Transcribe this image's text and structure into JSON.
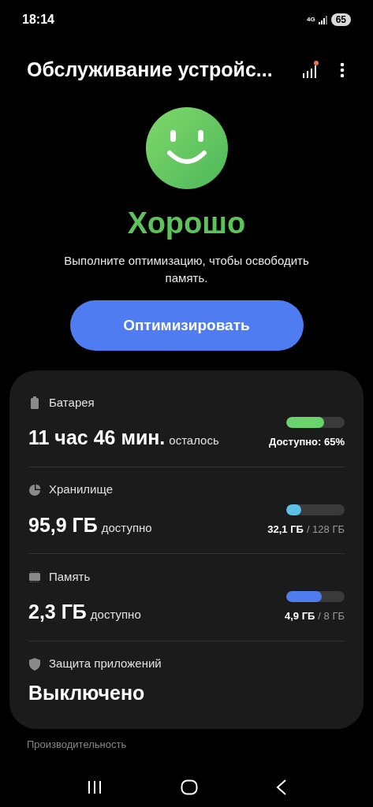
{
  "status_bar": {
    "time": "18:14",
    "network": "4G",
    "battery": "65"
  },
  "app_bar": {
    "title": "Обслуживание устройс...",
    "notification_dot": true
  },
  "status": {
    "label": "Хорошо",
    "message": "Выполните оптимизацию, чтобы освободить память."
  },
  "optimize_button": "Оптимизировать",
  "items": [
    {
      "kind": "battery",
      "title": "Батарея",
      "value": "11 час 46 мин.",
      "suffix": "осталось",
      "level": 0.65,
      "color": "#6bd36b",
      "detail_main": "Доступно: 65%"
    },
    {
      "kind": "storage",
      "title": "Хранилище",
      "value": "95,9 ГБ",
      "suffix": "доступно",
      "level": 0.25,
      "color": "#5bc0e6",
      "detail_main": "32,1 ГБ",
      "detail_total": "/ 128 ГБ"
    },
    {
      "kind": "memory",
      "title": "Память",
      "value": "2,3 ГБ",
      "suffix": "доступно",
      "level": 0.61,
      "color": "#4f7df0",
      "detail_main": "4,9 ГБ",
      "detail_total": "/ 8 ГБ"
    },
    {
      "kind": "protection",
      "title": "Защита приложений",
      "value": "Выключено"
    }
  ],
  "next_section": "Производительность"
}
